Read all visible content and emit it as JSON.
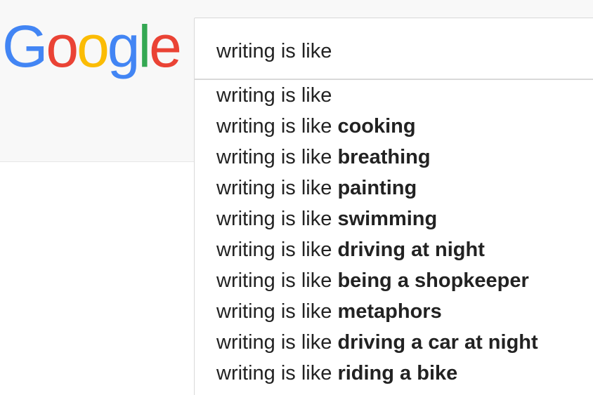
{
  "logo": {
    "letters": [
      "G",
      "o",
      "o",
      "g",
      "l",
      "e"
    ],
    "colors": [
      "#4285f4",
      "#ea4335",
      "#fbbc05",
      "#4285f4",
      "#34a853",
      "#ea4335"
    ]
  },
  "search": {
    "query": "writing is like"
  },
  "suggestions": [
    {
      "prefix": "writing is like",
      "completion": ""
    },
    {
      "prefix": "writing is like ",
      "completion": "cooking"
    },
    {
      "prefix": "writing is like ",
      "completion": "breathing"
    },
    {
      "prefix": "writing is like ",
      "completion": "painting"
    },
    {
      "prefix": "writing is like ",
      "completion": "swimming"
    },
    {
      "prefix": "writing is like ",
      "completion": "driving at night"
    },
    {
      "prefix": "writing is like ",
      "completion": "being a shopkeeper"
    },
    {
      "prefix": "writing is like ",
      "completion": "metaphors"
    },
    {
      "prefix": "writing is like ",
      "completion": "driving a car at night"
    },
    {
      "prefix": "writing is like ",
      "completion": "riding a bike"
    }
  ]
}
